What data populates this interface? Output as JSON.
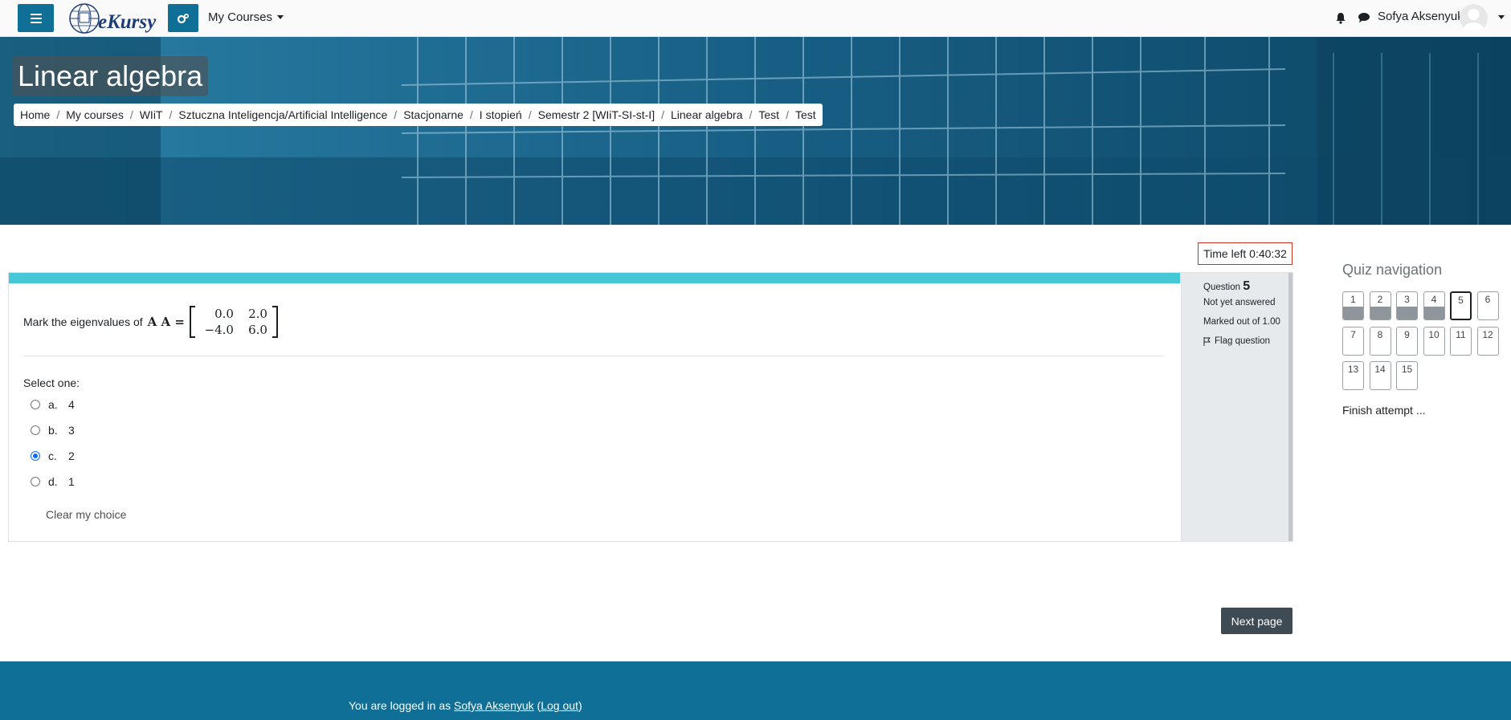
{
  "navbar": {
    "logo_text": "eKursy",
    "my_courses_label": "My Courses",
    "user_name": "Sofya Aksenyuk",
    "icons": [
      "hamburger-icon",
      "cogs-icon",
      "bell-icon",
      "chat-icon",
      "user-avatar",
      "caret-down-icon"
    ]
  },
  "hero": {
    "title": "Linear algebra",
    "breadcrumb": [
      "Home",
      "My courses",
      "WIiT",
      "Sztuczna Inteligencja/Artificial Intelligence",
      "Stacjonarne",
      "I stopień",
      "Semestr 2 [WIiT-SI-st-I]",
      "Linear algebra",
      "Test",
      "Test"
    ]
  },
  "timer": {
    "label": "Time left 0:40:32"
  },
  "question": {
    "prompt": "Mark the eigenvalues of",
    "matrix_label": "A A =",
    "matrix": [
      [
        "0.0",
        "2.0"
      ],
      [
        "−4.0",
        "6.0"
      ]
    ],
    "select_label": "Select one:",
    "options": [
      {
        "letter": "a.",
        "value": "4",
        "selected": false
      },
      {
        "letter": "b.",
        "value": "3",
        "selected": false
      },
      {
        "letter": "c.",
        "value": "2",
        "selected": true
      },
      {
        "letter": "d.",
        "value": "1",
        "selected": false
      }
    ],
    "clear_label": "Clear my choice"
  },
  "question_info": {
    "question_word": "Question",
    "number": "5",
    "status": "Not yet answered",
    "marked_out": "Marked out of 1.00",
    "flag_label": "Flag question"
  },
  "quiz_nav": {
    "title": "Quiz navigation",
    "buttons": [
      {
        "n": "1",
        "state": "answered"
      },
      {
        "n": "2",
        "state": "answered"
      },
      {
        "n": "3",
        "state": "answered"
      },
      {
        "n": "4",
        "state": "answered"
      },
      {
        "n": "5",
        "state": "current"
      },
      {
        "n": "6",
        "state": "empty"
      },
      {
        "n": "7",
        "state": "empty"
      },
      {
        "n": "8",
        "state": "empty"
      },
      {
        "n": "9",
        "state": "empty"
      },
      {
        "n": "10",
        "state": "empty"
      },
      {
        "n": "11",
        "state": "empty"
      },
      {
        "n": "12",
        "state": "empty"
      },
      {
        "n": "13",
        "state": "empty"
      },
      {
        "n": "14",
        "state": "empty"
      },
      {
        "n": "15",
        "state": "empty"
      }
    ],
    "finish_label": "Finish attempt ..."
  },
  "next_page_label": "Next page",
  "footer": {
    "logged_in_prefix": "You are logged in as",
    "user_link": "Sofya Aksenyuk",
    "logout_label": "Log out"
  },
  "colors": {
    "primary": "#0f6f97",
    "question_bar": "#44c8d5",
    "timer_border": "#ca3120",
    "next_button": "#3e4a54"
  }
}
